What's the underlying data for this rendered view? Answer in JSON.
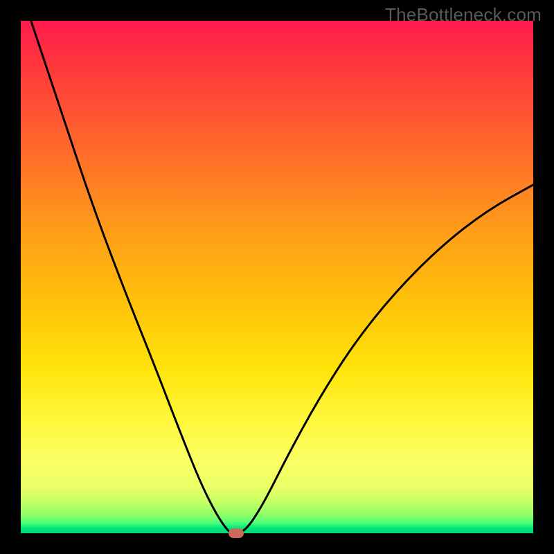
{
  "watermark": "TheBottleneck.com",
  "chart_data": {
    "type": "line",
    "title": "",
    "xlabel": "",
    "ylabel": "",
    "xlim": [
      0,
      100
    ],
    "ylim": [
      0,
      100
    ],
    "background_gradient": {
      "top_color": "#ff1a4d",
      "mid_color": "#ffe40a",
      "bottom_color": "#00d97a"
    },
    "series": [
      {
        "name": "bottleneck-curve",
        "color": "#000000",
        "points": [
          {
            "x": 2,
            "y": 100
          },
          {
            "x": 8,
            "y": 82
          },
          {
            "x": 14,
            "y": 64
          },
          {
            "x": 20,
            "y": 48
          },
          {
            "x": 26,
            "y": 33
          },
          {
            "x": 31,
            "y": 20
          },
          {
            "x": 35,
            "y": 10
          },
          {
            "x": 38,
            "y": 4
          },
          {
            "x": 40,
            "y": 1
          },
          {
            "x": 41,
            "y": 0
          },
          {
            "x": 43,
            "y": 0
          },
          {
            "x": 45,
            "y": 2
          },
          {
            "x": 48,
            "y": 7
          },
          {
            "x": 52,
            "y": 15
          },
          {
            "x": 58,
            "y": 26
          },
          {
            "x": 65,
            "y": 37
          },
          {
            "x": 73,
            "y": 47
          },
          {
            "x": 82,
            "y": 56
          },
          {
            "x": 91,
            "y": 63
          },
          {
            "x": 100,
            "y": 68
          }
        ]
      }
    ],
    "marker": {
      "name": "optimal-point",
      "shape": "rounded-rect",
      "color": "#c96a5a",
      "x": 42,
      "y": 0
    }
  }
}
